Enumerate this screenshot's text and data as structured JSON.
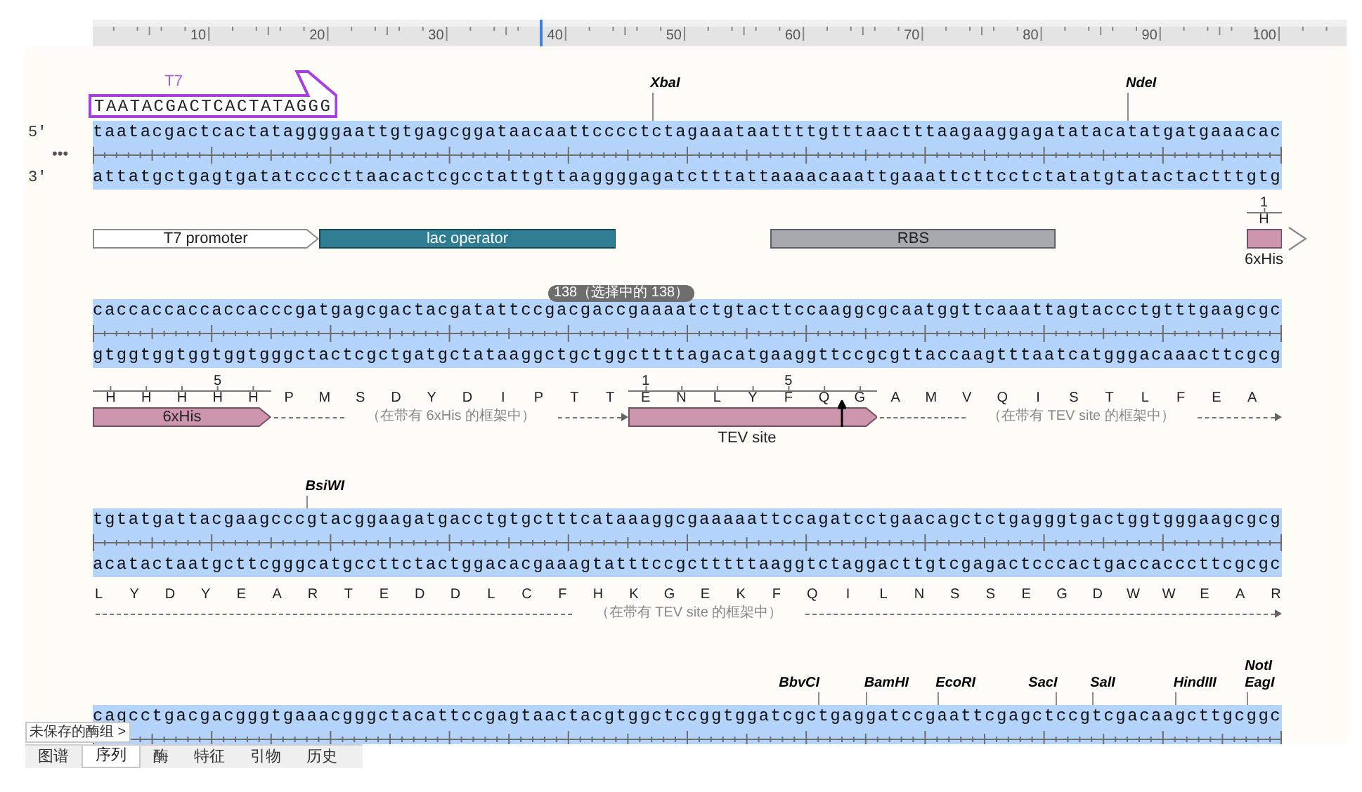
{
  "ruler": {
    "ticks": [
      "10",
      "20",
      "30",
      "40",
      "50",
      "60",
      "70",
      "80",
      "90",
      "100"
    ]
  },
  "rows": [
    {
      "primers": [
        {
          "name": "T7",
          "sequence": "TAATACGACTCACTATAGGG"
        }
      ],
      "enzymes": [
        {
          "names": [
            "XbaI"
          ]
        },
        {
          "names": [
            "NdeI"
          ]
        }
      ],
      "strand_labels": [
        "5′",
        "3′"
      ],
      "overflow_mark": "•••",
      "top_strand": "taatacgactcactataggggaattgtgagcggataacaattcccctctagaaataattttgtttaactttaagaaggagatatacatatgatgaaacac",
      "bottom_strand": "attatgctgagtgatatccccttaacactcgcctattgttaaggggagatctttattaaaacaaattgaaattcttcctctatatgtatactactttgtg",
      "features": [
        {
          "kind": "arrow",
          "name": "T7 promoter",
          "color": "#ffffff"
        },
        {
          "kind": "box",
          "name": "lac operator",
          "color": "#2e7d92"
        },
        {
          "kind": "box",
          "name": "RBS",
          "color": "#a6aaae"
        },
        {
          "kind": "stub",
          "name": "6xHis",
          "color": "#cd95ae",
          "residues": [
            {
              "aa": "H",
              "number": "1",
              "ruled": true
            }
          ]
        }
      ]
    },
    {
      "badge": "138（选择中的 138）",
      "top_strand": "caccaccaccaccacccgatgagcgactacgatattccgacgaccgaaaatctgtacttccaaggcgcaatggttcaaattagtaccctgtttgaagcgc",
      "bottom_strand": "gtggtggtggtggtgggctactcgctgatgctataaggctgctggcttttagacatgaaggttccgcgttaccaagtttaatcatgggacaaacttcgcg",
      "translation": [
        {
          "aa": "H",
          "ruled": true
        },
        {
          "aa": "H",
          "ruled": true
        },
        {
          "aa": "H",
          "ruled": true
        },
        {
          "aa": "H",
          "number": "5",
          "ruled": true
        },
        {
          "aa": "H",
          "ruled": true
        },
        {
          "aa": "P",
          "ruled": false
        },
        {
          "aa": "M",
          "ruled": false
        },
        {
          "aa": "S",
          "ruled": false
        },
        {
          "aa": "D",
          "ruled": false
        },
        {
          "aa": "Y",
          "ruled": false
        },
        {
          "aa": "D",
          "ruled": false
        },
        {
          "aa": "I",
          "ruled": false
        },
        {
          "aa": "P",
          "ruled": false
        },
        {
          "aa": "T",
          "ruled": false
        },
        {
          "aa": "T",
          "ruled": false
        },
        {
          "aa": "E",
          "number": "1",
          "ruled": true
        },
        {
          "aa": "N",
          "ruled": true
        },
        {
          "aa": "L",
          "ruled": true
        },
        {
          "aa": "Y",
          "ruled": true
        },
        {
          "aa": "F",
          "number": "5",
          "ruled": true
        },
        {
          "aa": "Q",
          "ruled": true
        },
        {
          "aa": "G",
          "ruled": true
        },
        {
          "aa": "A",
          "ruled": false
        },
        {
          "aa": "M",
          "ruled": false
        },
        {
          "aa": "V",
          "ruled": false
        },
        {
          "aa": "Q",
          "ruled": false
        },
        {
          "aa": "I",
          "ruled": false
        },
        {
          "aa": "S",
          "ruled": false
        },
        {
          "aa": "T",
          "ruled": false
        },
        {
          "aa": "L",
          "ruled": false
        },
        {
          "aa": "F",
          "ruled": false
        },
        {
          "aa": "E",
          "ruled": false
        },
        {
          "aa": "A",
          "ruled": false
        }
      ],
      "features": [
        {
          "kind": "arrow",
          "name": "6xHis",
          "color": "#cd95ae"
        },
        {
          "kind": "arrow_below",
          "name": "TEV site",
          "color": "#cd95ae"
        }
      ],
      "frame_notes": [
        "（在带有 6xHis 的框架中）",
        "（在带有 TEV site 的框架中）"
      ]
    },
    {
      "enzymes": [
        {
          "names": [
            "BsiWI"
          ]
        }
      ],
      "top_strand": "tgtatgattacgaagcccgtacggaagatgacctgtgctttcataaaggcgaaaaattccagatcctgaacagctctgagggtgactggtgggaagcgcg",
      "bottom_strand": "acatactaatgcttcgggcatgccttctactggacacgaaagtatttccgctttttaaggtctaggacttgtcgagactcccactgaccacccttcgcgc",
      "translation": [
        {
          "aa": "L",
          "ruled": false
        },
        {
          "aa": "Y",
          "ruled": false
        },
        {
          "aa": "D",
          "ruled": false
        },
        {
          "aa": "Y",
          "ruled": false
        },
        {
          "aa": "E",
          "ruled": false
        },
        {
          "aa": "A",
          "ruled": false
        },
        {
          "aa": "R",
          "ruled": false
        },
        {
          "aa": "T",
          "ruled": false
        },
        {
          "aa": "E",
          "ruled": false
        },
        {
          "aa": "D",
          "ruled": false
        },
        {
          "aa": "D",
          "ruled": false
        },
        {
          "aa": "L",
          "ruled": false
        },
        {
          "aa": "C",
          "ruled": false
        },
        {
          "aa": "F",
          "ruled": false
        },
        {
          "aa": "H",
          "ruled": false
        },
        {
          "aa": "K",
          "ruled": false
        },
        {
          "aa": "G",
          "ruled": false
        },
        {
          "aa": "E",
          "ruled": false
        },
        {
          "aa": "K",
          "ruled": false
        },
        {
          "aa": "F",
          "ruled": false
        },
        {
          "aa": "Q",
          "ruled": false
        },
        {
          "aa": "I",
          "ruled": false
        },
        {
          "aa": "L",
          "ruled": false
        },
        {
          "aa": "N",
          "ruled": false
        },
        {
          "aa": "S",
          "ruled": false
        },
        {
          "aa": "S",
          "ruled": false
        },
        {
          "aa": "E",
          "ruled": false
        },
        {
          "aa": "G",
          "ruled": false
        },
        {
          "aa": "D",
          "ruled": false
        },
        {
          "aa": "W",
          "ruled": false
        },
        {
          "aa": "W",
          "ruled": false
        },
        {
          "aa": "E",
          "ruled": false
        },
        {
          "aa": "A",
          "ruled": false
        },
        {
          "aa": "R",
          "ruled": false
        }
      ],
      "frame_notes": [
        "（在带有 TEV site 的框架中）"
      ]
    },
    {
      "enzymes": [
        {
          "names": [
            "BbvCI"
          ]
        },
        {
          "names": [
            "BamHI"
          ]
        },
        {
          "names": [
            "EcoRI"
          ]
        },
        {
          "names": [
            "SacI"
          ]
        },
        {
          "names": [
            "SalI"
          ]
        },
        {
          "names": [
            "HindIII"
          ]
        },
        {
          "names": [
            "NotI",
            "EagI"
          ]
        }
      ],
      "top_strand": "cagcctgacgacgggtgaaacgggctacattccgagtaactacgtggctccggtggatcgctgaggatccgaattcgagctccgtcgacaagcttgcggc"
    }
  ],
  "enzyme_set_label": "未保存的酶组 >",
  "tabs": [
    {
      "label": "图谱",
      "selected": false
    },
    {
      "label": "序列",
      "selected": true
    },
    {
      "label": "酶",
      "selected": false
    },
    {
      "label": "特征",
      "selected": false
    },
    {
      "label": "引物",
      "selected": false
    },
    {
      "label": "历史",
      "selected": false
    }
  ]
}
